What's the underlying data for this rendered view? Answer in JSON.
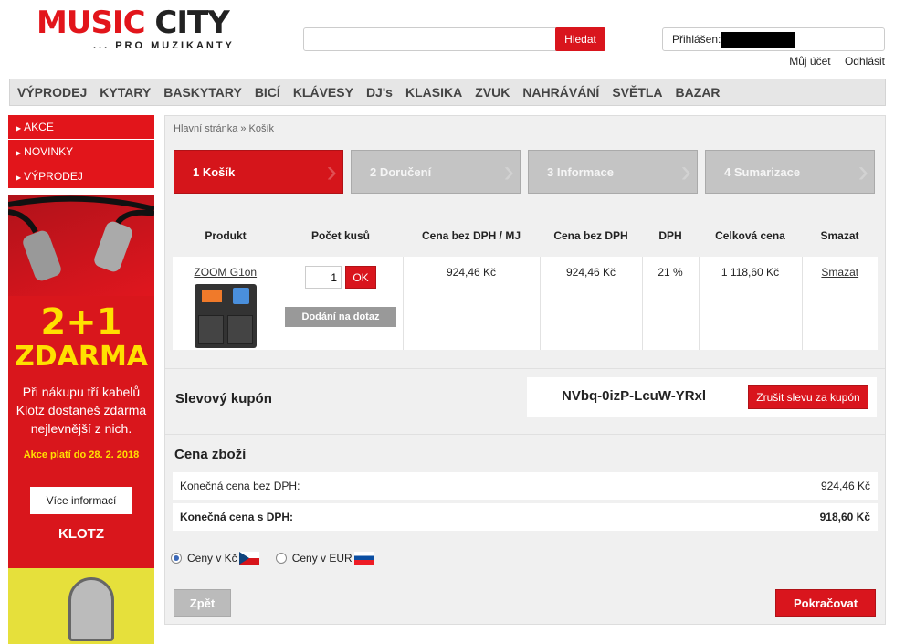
{
  "header": {
    "logo_main_1": "MUSIC",
    "logo_main_2": "CITY",
    "logo_sub": "... PRO MUZIKANTY",
    "search_placeholder": "",
    "search_button": "Hledat",
    "login_label": "Přihlášen:",
    "my_account": "Můj účet",
    "logout": "Odhlásit"
  },
  "nav": [
    "VÝPRODEJ",
    "KYTARY",
    "BASKYTARY",
    "BICÍ",
    "KLÁVESY",
    "DJ's",
    "KLASIKA",
    "ZVUK",
    "NAHRÁVÁNÍ",
    "SVĚTLA",
    "BAZAR"
  ],
  "sidebar": {
    "items": [
      "AKCE",
      "NOVINKY",
      "VÝPRODEJ"
    ],
    "banner": {
      "big_1": "2+1",
      "big_2": "ZDARMA",
      "desc": "Při nákupu tří kabelů Klotz dostaneš zdarma nejlevnější z nich.",
      "valid": "Akce platí do 28. 2. 2018",
      "more_button": "Více informací",
      "brand": "KLOTZ"
    }
  },
  "breadcrumb": "Hlavní stránka » Košík",
  "steps": [
    "1 Košík",
    "2 Doručení",
    "3 Informace",
    "4 Sumarizace"
  ],
  "cart": {
    "headers": [
      "Produkt",
      "Počet kusů",
      "Cena bez DPH / MJ",
      "Cena bez DPH",
      "DPH",
      "Celková cena",
      "Smazat"
    ],
    "item": {
      "product": "ZOOM G1on",
      "quantity": "1",
      "ok_button": "OK",
      "delivery_button": "Dodání na dotaz",
      "unit_price": "924,46 Kč",
      "price_no_vat": "924,46 Kč",
      "vat": "21 %",
      "total": "1 118,60 Kč",
      "delete": "Smazat"
    }
  },
  "coupon": {
    "label": "Slevový kupón",
    "code": "NVbq-0izP-LcuW-YRxl",
    "cancel_button": "Zrušit slevu za kupón"
  },
  "totals": {
    "heading": "Cena zboží",
    "row1_label": "Konečná cena bez DPH:",
    "row1_value": "924,46 Kč",
    "row2_label": "Konečná cena s DPH:",
    "row2_value": "918,60 Kč"
  },
  "currency": {
    "czk_label": "Ceny v Kč",
    "eur_label": "Ceny v EUR",
    "selected": "CZK"
  },
  "buttons": {
    "back": "Zpět",
    "continue": "Pokračovat"
  }
}
